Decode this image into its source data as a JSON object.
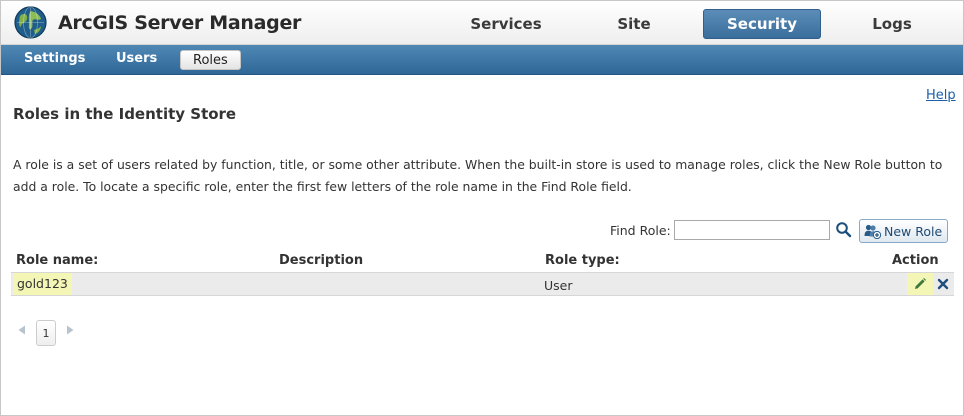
{
  "header": {
    "app_title": "ArcGIS Server Manager",
    "logo_icon": "globe-icon",
    "nav_tabs": [
      {
        "label": "Services",
        "active": false
      },
      {
        "label": "Site",
        "active": false
      },
      {
        "label": "Security",
        "active": true
      },
      {
        "label": "Logs",
        "active": false
      }
    ]
  },
  "subnav": {
    "items": [
      {
        "label": "Settings",
        "active": false
      },
      {
        "label": "Users",
        "active": false
      },
      {
        "label": "Roles",
        "active": true
      }
    ]
  },
  "help_link": "Help",
  "page_title": "Roles in the Identity Store",
  "description": "A role is a set of users related by function, title, or some other attribute. When the built-in store is used to manage roles, click the New Role button to add a role. To locate a specific role, enter the first few letters of the role name in the Find Role field.",
  "find_role": {
    "label": "Find Role:",
    "value": "",
    "search_icon": "search-icon"
  },
  "new_role_button": {
    "label": "New Role",
    "icon": "add-role-icon"
  },
  "table": {
    "headers": {
      "role_name": "Role name:",
      "description": "Description",
      "role_type": "Role type:",
      "action": "Action"
    },
    "rows": [
      {
        "role_name": "gold123",
        "description": "",
        "role_type": "User",
        "actions": [
          "edit-icon",
          "delete-icon"
        ]
      }
    ]
  },
  "pagination": {
    "current_page": "1"
  },
  "colors": {
    "accent": "#3a6e9c",
    "highlight": "#f3f6b4",
    "link": "#1a5fa8"
  }
}
